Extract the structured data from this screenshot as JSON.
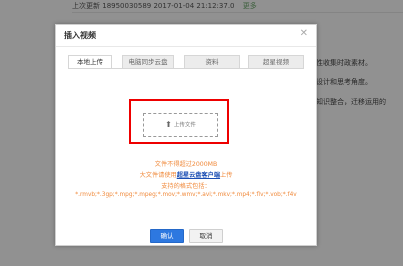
{
  "background": {
    "last_update_label": "上次更新",
    "last_update_user": "18950030589",
    "last_update_time": "2017-01-04 21:12:37.0",
    "more_link": "更多",
    "text_line1": "性收集时政素材。",
    "text_line2": "设计和思考角度。",
    "text_line3": "知识整合，迁移运用的"
  },
  "dialog": {
    "title": "插入视频",
    "close_icon": "close-icon",
    "tabs": [
      {
        "label": "本地上传",
        "active": true
      },
      {
        "label": "电脑同步云盘",
        "active": false
      },
      {
        "label": "资料",
        "active": false
      },
      {
        "label": "超星视频",
        "active": false
      }
    ],
    "upload_button_label": "上传文件",
    "upload_icon": "upload-icon",
    "info_size": "文件不得超过2000MB",
    "info_big_prefix": "大文件请使用",
    "info_big_link": "超星云盘客户端",
    "info_big_suffix": "上传",
    "info_formats_label": "支持的格式包括：",
    "info_formats": "*.rmvb;*.3gp;*.mpg;*.mpeg;*.mov;*.wmv;*.avi;*.mkv;*.mp4;*.flv;*.vob;*.f4v",
    "ok_label": "确认",
    "cancel_label": "取消"
  },
  "colors": {
    "highlight": "#ee0000",
    "primary_button": "#2d78e0",
    "info_text": "#f08a3c",
    "link": "#1a4db3"
  }
}
